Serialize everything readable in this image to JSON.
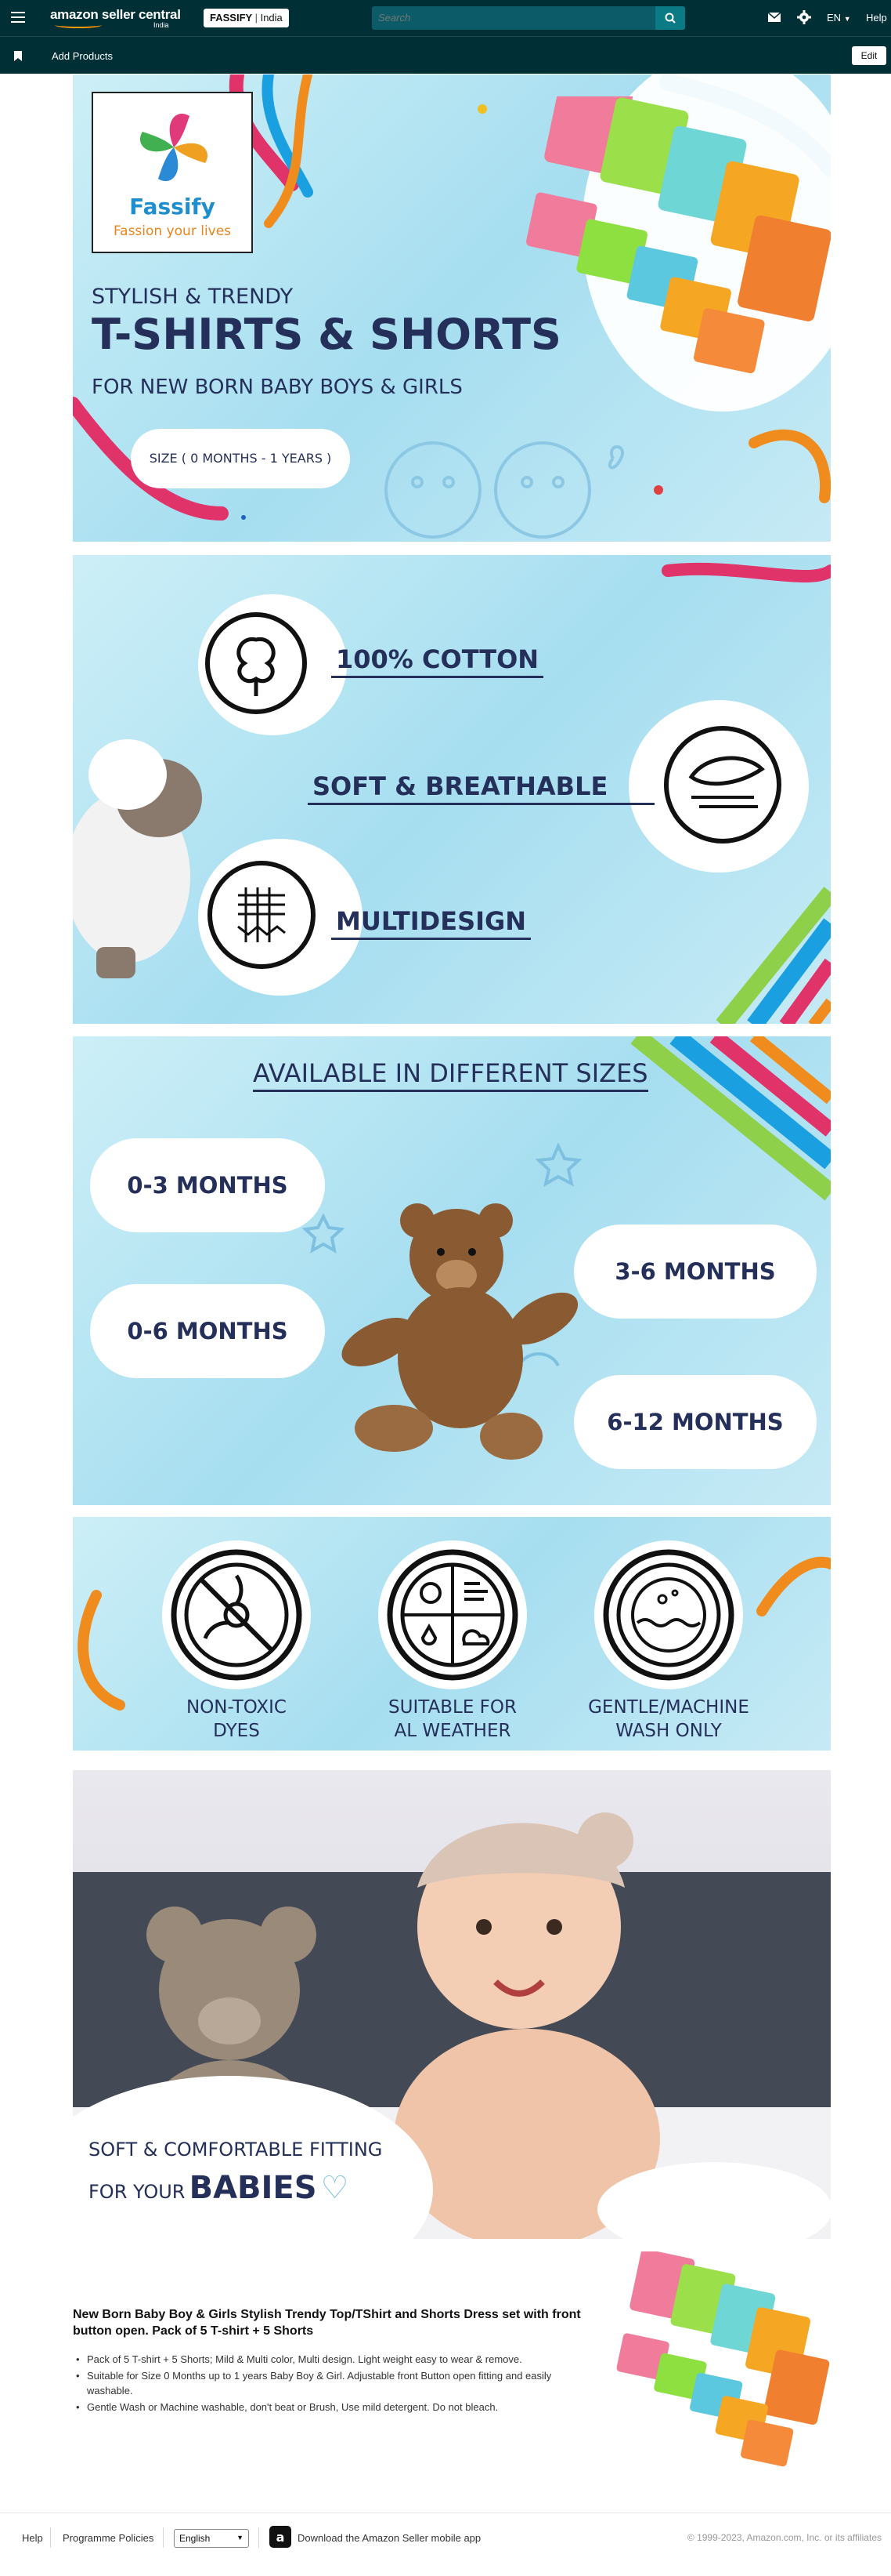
{
  "topbar": {
    "brand": "amazon seller central",
    "brand_sub": "India",
    "store": "FASSIFY",
    "store_region": "India",
    "search_placeholder": "Search",
    "language": "EN",
    "help": "Help"
  },
  "subbar": {
    "add_products": "Add Products",
    "edit": "Edit"
  },
  "banner1": {
    "logo_name": "Fassify",
    "logo_tagline": "Fassion your lives",
    "eyebrow": "STYLISH & TRENDY",
    "title": "T-SHIRTS & SHORTS",
    "subtitle": "FOR NEW BORN BABY BOYS & GIRLS",
    "size_note": "SIZE ( 0 MONTHS - 1 YEARS )"
  },
  "banner2": {
    "features": [
      "100% COTTON",
      "SOFT & BREATHABLE",
      "MULTIDESIGN"
    ]
  },
  "banner3": {
    "title": "AVAILABLE IN DIFFERENT SIZES",
    "sizes": [
      "0-3 MONTHS",
      "0-6 MONTHS",
      "3-6 MONTHS",
      "6-12 MONTHS"
    ]
  },
  "banner4": {
    "care": [
      {
        "line1": "NON-TOXIC",
        "line2": "DYES"
      },
      {
        "line1": "SUITABLE FOR",
        "line2": "AL WEATHER"
      },
      {
        "line1": "GENTLE/MACHINE",
        "line2": "WASH ONLY"
      }
    ]
  },
  "banner5": {
    "line1": "SOFT & COMFORTABLE FITTING",
    "line2a": "FOR YOUR",
    "line2b": "BABIES"
  },
  "listing": {
    "title": "New Born Baby Boy & Girls Stylish Trendy Top/TShirt and Shorts Dress set with front button open. Pack of 5 T-shirt + 5 Shorts",
    "bullets": [
      "Pack of 5 T-shirt + 5 Shorts; Mild & Multi color, Multi design. Light weight easy to wear & remove.",
      "Suitable for Size 0 Months up to 1 years Baby Boy & Girl. Adjustable front Button open fitting and easily washable.",
      "Gentle Wash or Machine washable, don't beat or Brush, Use mild detergent. Do not bleach."
    ]
  },
  "footer": {
    "help": "Help",
    "policies": "Programme Policies",
    "language": "English",
    "app": "Download the Amazon Seller mobile app",
    "copyright": "© 1999-2023, Amazon.com, Inc. or its affiliates"
  },
  "colors": {
    "nav_bg": "#002f36",
    "heading": "#25305a",
    "logo_blue": "#1e8ecf",
    "logo_orange": "#e8841d",
    "panel_blue": "#a6def0"
  }
}
